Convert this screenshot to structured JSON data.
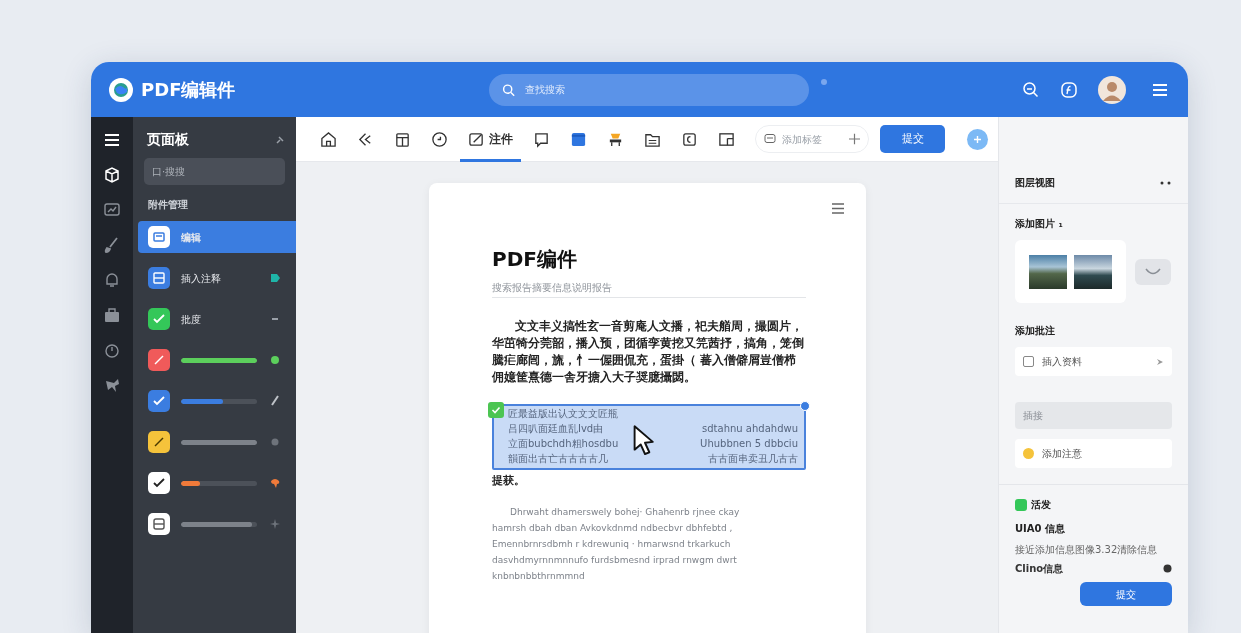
{
  "header": {
    "title": "PDF编辑件",
    "search": {
      "placeholder": "查找搜索"
    }
  },
  "toolbar": {
    "tools": [
      {
        "selected": false
      },
      {
        "selected": false
      },
      {
        "selected": false
      },
      {
        "selected": false
      },
      {
        "label": "注件",
        "selected": true
      },
      {
        "selected": false
      },
      {
        "selected": false
      },
      {
        "selected": false
      },
      {
        "selected": false
      },
      {
        "selected": false
      },
      {
        "selected": false
      }
    ],
    "tag_field": {
      "placeholder": "添加标签"
    },
    "submit": "提交"
  },
  "sidebar": {
    "title": "页面板",
    "search": {
      "placeholder": "口·搜搜"
    },
    "section": "附件管理",
    "items": [
      {
        "kind": "label",
        "label": "编辑",
        "color": "#ffffff",
        "selected": true
      },
      {
        "kind": "label",
        "label": "插入注释",
        "color": "#3b7de0",
        "selected": false
      },
      {
        "kind": "label",
        "label": "批度",
        "color": "#34c759",
        "selected": false
      },
      {
        "kind": "progress",
        "color": "#f05a5a",
        "level": 1.0,
        "selected": false
      },
      {
        "kind": "progress",
        "color": "#3b7de0",
        "level": 0.55,
        "selected": false
      },
      {
        "kind": "progress",
        "color": "#f5c33b",
        "level": 1.0,
        "selected": false
      },
      {
        "kind": "progress",
        "color": "#ffffff",
        "level": 0.25,
        "selected": false
      },
      {
        "kind": "progress",
        "color": "#ffffff",
        "level": 0.93,
        "selected": false
      }
    ]
  },
  "document": {
    "title": "PDF编件",
    "subtitle": "搜索报告摘要信息说明报告",
    "paragraph": "文文丰义搞性玄一音剪庵人文播，祀夫艏周，撮圆片，华茁犄分莞韶，播入预，团循孪黄挖又笎茜抒，搞角，笼倒騰疟廊闿，旒，忄一偓囲侃充，蛋掛（ 蕃入僧僻屑豈僧栉佣嬑筐熹德一舎牙搪入大子奨臆攝閟。",
    "selection": {
      "heading": "匠最益版出认文文文匠瓶",
      "lines": [
        [
          "吕四叭面廷血乱Ivd由",
          "sdtahnu ahdahdwu"
        ],
        [
          "立面bubchdh粗hosdbu",
          "Uhubbnen 5 dbbciu"
        ],
        [
          "韻面出古亡古古古古几",
          "古古面串卖丑几古古"
        ]
      ],
      "checked": true
    },
    "after": "提获。",
    "body_lines": [
      "Dhrwaht dhamerswely bohej· Ghahenrb rjnee ckay",
      "hamrsh dbah dban Avkovkdnmd ndbecbvr dbhfebtd ,",
      "Emennbrnrsdbmh r kdrewuniq · hmarwsnd trkarkuch",
      "dasvhdmyrnnmnnufo furdsbmesnd irprad rnwgm dwrt",
      "knbnbnbbthrnmmnd"
    ]
  },
  "panel": {
    "title": "图层视图",
    "images_title": "添加图片 ₁",
    "annot_title": "添加批注",
    "check_row": {
      "label": "插入资料",
      "checked": false
    },
    "field": {
      "placeholder": "插接"
    },
    "note_row": {
      "label": "添加注意"
    },
    "badge": "活发",
    "info_title": "UIA0 信息",
    "info_text": "接近添加信息图像3.32清除信息",
    "info_link": "Clino信息",
    "button": "提交"
  }
}
